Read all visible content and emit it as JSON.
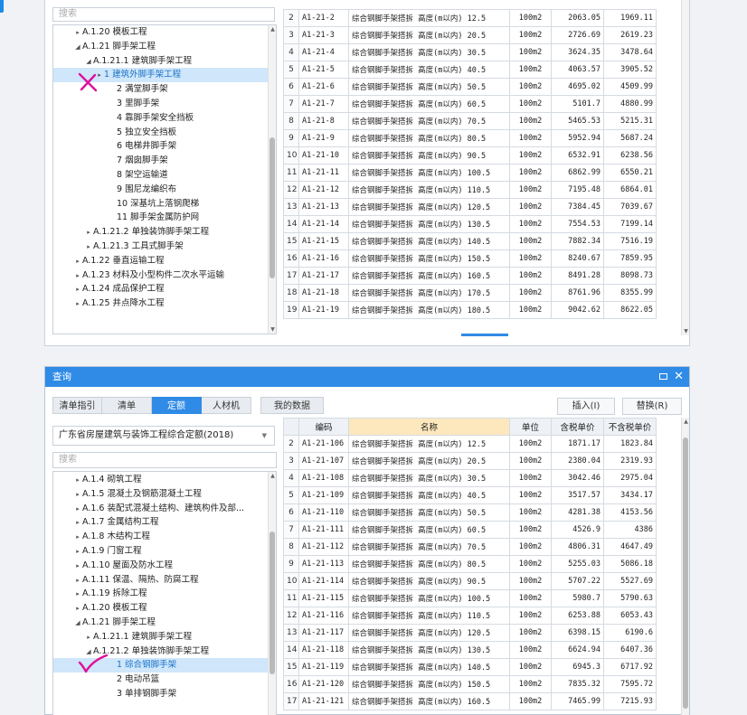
{
  "top_panel": {
    "search_placeholder": "搜索",
    "tree": [
      {
        "level": 1,
        "arrow": "▸",
        "label": "A.1.20 模板工程"
      },
      {
        "level": 1,
        "arrow": "◢",
        "label": "A.1.21 脚手架工程"
      },
      {
        "level": 2,
        "arrow": "◢",
        "label": "A.1.21.1 建筑脚手架工程"
      },
      {
        "level": 3,
        "arrow": "▸",
        "label": "1 建筑外脚手架工程",
        "selected": true
      },
      {
        "level": 4,
        "arrow": "",
        "label": "2 满堂脚手架"
      },
      {
        "level": 4,
        "arrow": "",
        "label": "3 里脚手架"
      },
      {
        "level": 4,
        "arrow": "",
        "label": "4 靠脚手架安全挡板"
      },
      {
        "level": 4,
        "arrow": "",
        "label": "5 独立安全挡板"
      },
      {
        "level": 4,
        "arrow": "",
        "label": "6 电梯井脚手架"
      },
      {
        "level": 4,
        "arrow": "",
        "label": "7 烟囱脚手架"
      },
      {
        "level": 4,
        "arrow": "",
        "label": "8 架空运输道"
      },
      {
        "level": 4,
        "arrow": "",
        "label": "9 围尼龙编织布"
      },
      {
        "level": 4,
        "arrow": "",
        "label": "10 深基坑上落钢爬梯"
      },
      {
        "level": 4,
        "arrow": "",
        "label": "11 脚手架金属防护网"
      },
      {
        "level": 2,
        "arrow": "▸",
        "label": "A.1.21.2 单独装饰脚手架工程"
      },
      {
        "level": 2,
        "arrow": "▸",
        "label": "A.1.21.3 工具式脚手架"
      },
      {
        "level": 1,
        "arrow": "▸",
        "label": "A.1.22 垂直运输工程"
      },
      {
        "level": 1,
        "arrow": "▸",
        "label": "A.1.23 材料及小型构件二次水平运输"
      },
      {
        "level": 1,
        "arrow": "▸",
        "label": "A.1.24 成品保护工程"
      },
      {
        "level": 1,
        "arrow": "▸",
        "label": "A.1.25 井点降水工程"
      }
    ],
    "rows": [
      {
        "idx": "2",
        "code": "A1-21-2",
        "name": "综合钢脚手架搭拆 高度(m以内) 12.5",
        "unit": "100m2",
        "tax": "2063.05",
        "notax": "1969.11"
      },
      {
        "idx": "3",
        "code": "A1-21-3",
        "name": "综合钢脚手架搭拆 高度(m以内) 20.5",
        "unit": "100m2",
        "tax": "2726.69",
        "notax": "2619.23"
      },
      {
        "idx": "4",
        "code": "A1-21-4",
        "name": "综合钢脚手架搭拆 高度(m以内) 30.5",
        "unit": "100m2",
        "tax": "3624.35",
        "notax": "3478.64"
      },
      {
        "idx": "5",
        "code": "A1-21-5",
        "name": "综合钢脚手架搭拆 高度(m以内) 40.5",
        "unit": "100m2",
        "tax": "4063.57",
        "notax": "3905.52"
      },
      {
        "idx": "6",
        "code": "A1-21-6",
        "name": "综合钢脚手架搭拆 高度(m以内) 50.5",
        "unit": "100m2",
        "tax": "4695.02",
        "notax": "4509.99"
      },
      {
        "idx": "7",
        "code": "A1-21-7",
        "name": "综合钢脚手架搭拆 高度(m以内) 60.5",
        "unit": "100m2",
        "tax": "5101.7",
        "notax": "4880.99"
      },
      {
        "idx": "8",
        "code": "A1-21-8",
        "name": "综合钢脚手架搭拆 高度(m以内) 70.5",
        "unit": "100m2",
        "tax": "5465.53",
        "notax": "5215.31"
      },
      {
        "idx": "9",
        "code": "A1-21-9",
        "name": "综合钢脚手架搭拆 高度(m以内) 80.5",
        "unit": "100m2",
        "tax": "5952.94",
        "notax": "5687.24"
      },
      {
        "idx": "10",
        "code": "A1-21-10",
        "name": "综合钢脚手架搭拆 高度(m以内) 90.5",
        "unit": "100m2",
        "tax": "6532.91",
        "notax": "6238.56"
      },
      {
        "idx": "11",
        "code": "A1-21-11",
        "name": "综合钢脚手架搭拆 高度(m以内) 100.5",
        "unit": "100m2",
        "tax": "6862.99",
        "notax": "6550.21"
      },
      {
        "idx": "12",
        "code": "A1-21-12",
        "name": "综合钢脚手架搭拆 高度(m以内) 110.5",
        "unit": "100m2",
        "tax": "7195.48",
        "notax": "6864.01"
      },
      {
        "idx": "13",
        "code": "A1-21-13",
        "name": "综合钢脚手架搭拆 高度(m以内) 120.5",
        "unit": "100m2",
        "tax": "7384.45",
        "notax": "7039.67"
      },
      {
        "idx": "14",
        "code": "A1-21-14",
        "name": "综合钢脚手架搭拆 高度(m以内) 130.5",
        "unit": "100m2",
        "tax": "7554.53",
        "notax": "7199.14"
      },
      {
        "idx": "15",
        "code": "A1-21-15",
        "name": "综合钢脚手架搭拆 高度(m以内) 140.5",
        "unit": "100m2",
        "tax": "7882.34",
        "notax": "7516.19"
      },
      {
        "idx": "16",
        "code": "A1-21-16",
        "name": "综合钢脚手架搭拆 高度(m以内) 150.5",
        "unit": "100m2",
        "tax": "8240.67",
        "notax": "7859.95"
      },
      {
        "idx": "17",
        "code": "A1-21-17",
        "name": "综合钢脚手架搭拆 高度(m以内) 160.5",
        "unit": "100m2",
        "tax": "8491.28",
        "notax": "8098.73"
      },
      {
        "idx": "18",
        "code": "A1-21-18",
        "name": "综合钢脚手架搭拆 高度(m以内) 170.5",
        "unit": "100m2",
        "tax": "8761.96",
        "notax": "8355.99"
      },
      {
        "idx": "19",
        "code": "A1-21-19",
        "name": "综合钢脚手架搭拆 高度(m以内) 180.5",
        "unit": "100m2",
        "tax": "9042.62",
        "notax": "8622.05"
      }
    ]
  },
  "dialog": {
    "title": "查询",
    "tabs": [
      "清单指引",
      "清单",
      "定额",
      "人材机"
    ],
    "active_tab": "定额",
    "extra_tab": "我的数据",
    "insert_label": "插入(I)",
    "replace_label": "替换(R)",
    "dataset": "广东省房屋建筑与装饰工程综合定额(2018)",
    "search_placeholder": "搜索",
    "columns": {
      "code": "编码",
      "name": "名称",
      "unit": "单位",
      "tax": "含税单价",
      "notax": "不含税单价"
    },
    "tree": [
      {
        "level": 1,
        "arrow": "▸",
        "label": "A.1.4 砌筑工程"
      },
      {
        "level": 1,
        "arrow": "▸",
        "label": "A.1.5 混凝土及钢筋混凝土工程"
      },
      {
        "level": 1,
        "arrow": "▸",
        "label": "A.1.6 装配式混凝土结构、建筑构件及部..."
      },
      {
        "level": 1,
        "arrow": "▸",
        "label": "A.1.7 金属结构工程"
      },
      {
        "level": 1,
        "arrow": "▸",
        "label": "A.1.8 木结构工程"
      },
      {
        "level": 1,
        "arrow": "▸",
        "label": "A.1.9 门窗工程"
      },
      {
        "level": 1,
        "arrow": "▸",
        "label": "A.1.10 屋面及防水工程"
      },
      {
        "level": 1,
        "arrow": "▸",
        "label": "A.1.11 保温、隔热、防腐工程"
      },
      {
        "level": 1,
        "arrow": "▸",
        "label": "A.1.19 拆除工程"
      },
      {
        "level": 1,
        "arrow": "▸",
        "label": "A.1.20 模板工程"
      },
      {
        "level": 1,
        "arrow": "◢",
        "label": "A.1.21 脚手架工程"
      },
      {
        "level": 2,
        "arrow": "▸",
        "label": "A.1.21.1 建筑脚手架工程"
      },
      {
        "level": 2,
        "arrow": "◢",
        "label": "A.1.21.2 单独装饰脚手架工程"
      },
      {
        "level": 4,
        "arrow": "",
        "label": "1 综合钢脚手架",
        "selected": true
      },
      {
        "level": 4,
        "arrow": "",
        "label": "2 电动吊篮"
      },
      {
        "level": 4,
        "arrow": "",
        "label": "3 单排钢脚手架"
      }
    ],
    "rows": [
      {
        "idx": "2",
        "code": "A1-21-106",
        "name": "综合钢脚手架搭拆 高度(m以内) 12.5",
        "unit": "100m2",
        "tax": "1871.17",
        "notax": "1823.84"
      },
      {
        "idx": "3",
        "code": "A1-21-107",
        "name": "综合钢脚手架搭拆 高度(m以内) 20.5",
        "unit": "100m2",
        "tax": "2380.04",
        "notax": "2319.93"
      },
      {
        "idx": "4",
        "code": "A1-21-108",
        "name": "综合钢脚手架搭拆 高度(m以内) 30.5",
        "unit": "100m2",
        "tax": "3042.46",
        "notax": "2975.04"
      },
      {
        "idx": "5",
        "code": "A1-21-109",
        "name": "综合钢脚手架搭拆 高度(m以内) 40.5",
        "unit": "100m2",
        "tax": "3517.57",
        "notax": "3434.17"
      },
      {
        "idx": "6",
        "code": "A1-21-110",
        "name": "综合钢脚手架搭拆 高度(m以内) 50.5",
        "unit": "100m2",
        "tax": "4281.38",
        "notax": "4153.56"
      },
      {
        "idx": "7",
        "code": "A1-21-111",
        "name": "综合钢脚手架搭拆 高度(m以内) 60.5",
        "unit": "100m2",
        "tax": "4526.9",
        "notax": "4386"
      },
      {
        "idx": "8",
        "code": "A1-21-112",
        "name": "综合钢脚手架搭拆 高度(m以内) 70.5",
        "unit": "100m2",
        "tax": "4806.31",
        "notax": "4647.49"
      },
      {
        "idx": "9",
        "code": "A1-21-113",
        "name": "综合钢脚手架搭拆 高度(m以内) 80.5",
        "unit": "100m2",
        "tax": "5255.03",
        "notax": "5086.18"
      },
      {
        "idx": "10",
        "code": "A1-21-114",
        "name": "综合钢脚手架搭拆 高度(m以内) 90.5",
        "unit": "100m2",
        "tax": "5707.22",
        "notax": "5527.69"
      },
      {
        "idx": "11",
        "code": "A1-21-115",
        "name": "综合钢脚手架搭拆 高度(m以内) 100.5",
        "unit": "100m2",
        "tax": "5980.7",
        "notax": "5790.63"
      },
      {
        "idx": "12",
        "code": "A1-21-116",
        "name": "综合钢脚手架搭拆 高度(m以内) 110.5",
        "unit": "100m2",
        "tax": "6253.88",
        "notax": "6053.43"
      },
      {
        "idx": "13",
        "code": "A1-21-117",
        "name": "综合钢脚手架搭拆 高度(m以内) 120.5",
        "unit": "100m2",
        "tax": "6398.15",
        "notax": "6190.6"
      },
      {
        "idx": "14",
        "code": "A1-21-118",
        "name": "综合钢脚手架搭拆 高度(m以内) 130.5",
        "unit": "100m2",
        "tax": "6624.94",
        "notax": "6407.36"
      },
      {
        "idx": "15",
        "code": "A1-21-119",
        "name": "综合钢脚手架搭拆 高度(m以内) 140.5",
        "unit": "100m2",
        "tax": "6945.3",
        "notax": "6717.92"
      },
      {
        "idx": "16",
        "code": "A1-21-120",
        "name": "综合钢脚手架搭拆 高度(m以内) 150.5",
        "unit": "100m2",
        "tax": "7835.32",
        "notax": "7595.72"
      },
      {
        "idx": "17",
        "code": "A1-21-121",
        "name": "综合钢脚手架搭拆 高度(m以内) 160.5",
        "unit": "100m2",
        "tax": "7465.99",
        "notax": "7215.93"
      }
    ]
  },
  "colors": {
    "accent": "#2f8be6",
    "selected_row": "#cfe6fb",
    "name_header": "#fde8bd",
    "annotation": "#e0109a"
  }
}
